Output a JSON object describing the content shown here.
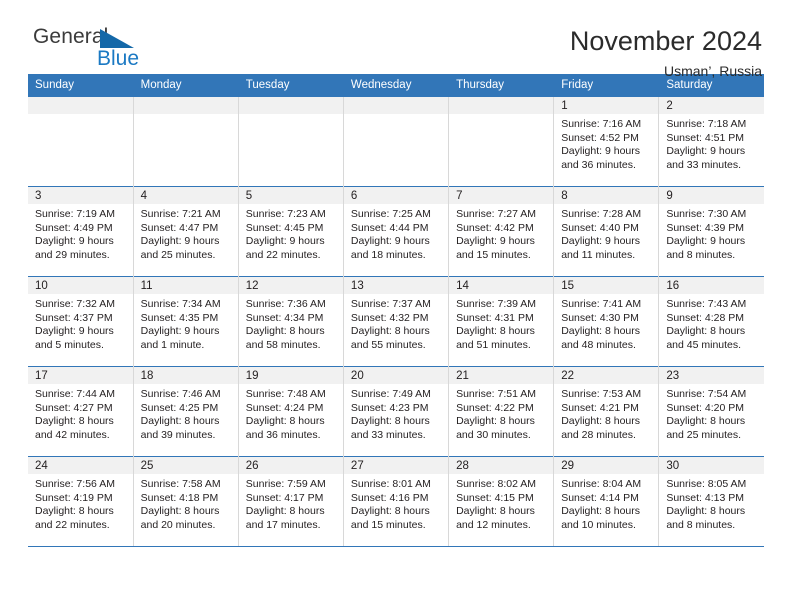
{
  "brand": {
    "name_top": "General",
    "name_bottom": "Blue",
    "triangle_color": "#1468a8",
    "blue_color": "#1b79c3"
  },
  "header": {
    "title": "November 2024",
    "subtitle": "Usman’, Russia"
  },
  "theme": {
    "header_blue": "#3276b8",
    "daynum_band": "#f1f1f1",
    "cell_divider": "#d8d8d8",
    "text": "#231f20"
  },
  "weekdays": [
    "Sunday",
    "Monday",
    "Tuesday",
    "Wednesday",
    "Thursday",
    "Friday",
    "Saturday"
  ],
  "labels": {
    "sunrise": "Sunrise:",
    "sunset": "Sunset:",
    "daylight": "Daylight:"
  },
  "weeks": [
    [
      {
        "day": "",
        "empty": true
      },
      {
        "day": "",
        "empty": true
      },
      {
        "day": "",
        "empty": true
      },
      {
        "day": "",
        "empty": true
      },
      {
        "day": "",
        "empty": true
      },
      {
        "day": "1",
        "sunrise": "Sunrise: 7:16 AM",
        "sunset": "Sunset: 4:52 PM",
        "daylight": "Daylight: 9 hours and 36 minutes."
      },
      {
        "day": "2",
        "sunrise": "Sunrise: 7:18 AM",
        "sunset": "Sunset: 4:51 PM",
        "daylight": "Daylight: 9 hours and 33 minutes."
      }
    ],
    [
      {
        "day": "3",
        "sunrise": "Sunrise: 7:19 AM",
        "sunset": "Sunset: 4:49 PM",
        "daylight": "Daylight: 9 hours and 29 minutes."
      },
      {
        "day": "4",
        "sunrise": "Sunrise: 7:21 AM",
        "sunset": "Sunset: 4:47 PM",
        "daylight": "Daylight: 9 hours and 25 minutes."
      },
      {
        "day": "5",
        "sunrise": "Sunrise: 7:23 AM",
        "sunset": "Sunset: 4:45 PM",
        "daylight": "Daylight: 9 hours and 22 minutes."
      },
      {
        "day": "6",
        "sunrise": "Sunrise: 7:25 AM",
        "sunset": "Sunset: 4:44 PM",
        "daylight": "Daylight: 9 hours and 18 minutes."
      },
      {
        "day": "7",
        "sunrise": "Sunrise: 7:27 AM",
        "sunset": "Sunset: 4:42 PM",
        "daylight": "Daylight: 9 hours and 15 minutes."
      },
      {
        "day": "8",
        "sunrise": "Sunrise: 7:28 AM",
        "sunset": "Sunset: 4:40 PM",
        "daylight": "Daylight: 9 hours and 11 minutes."
      },
      {
        "day": "9",
        "sunrise": "Sunrise: 7:30 AM",
        "sunset": "Sunset: 4:39 PM",
        "daylight": "Daylight: 9 hours and 8 minutes."
      }
    ],
    [
      {
        "day": "10",
        "sunrise": "Sunrise: 7:32 AM",
        "sunset": "Sunset: 4:37 PM",
        "daylight": "Daylight: 9 hours and 5 minutes."
      },
      {
        "day": "11",
        "sunrise": "Sunrise: 7:34 AM",
        "sunset": "Sunset: 4:35 PM",
        "daylight": "Daylight: 9 hours and 1 minute."
      },
      {
        "day": "12",
        "sunrise": "Sunrise: 7:36 AM",
        "sunset": "Sunset: 4:34 PM",
        "daylight": "Daylight: 8 hours and 58 minutes."
      },
      {
        "day": "13",
        "sunrise": "Sunrise: 7:37 AM",
        "sunset": "Sunset: 4:32 PM",
        "daylight": "Daylight: 8 hours and 55 minutes."
      },
      {
        "day": "14",
        "sunrise": "Sunrise: 7:39 AM",
        "sunset": "Sunset: 4:31 PM",
        "daylight": "Daylight: 8 hours and 51 minutes."
      },
      {
        "day": "15",
        "sunrise": "Sunrise: 7:41 AM",
        "sunset": "Sunset: 4:30 PM",
        "daylight": "Daylight: 8 hours and 48 minutes."
      },
      {
        "day": "16",
        "sunrise": "Sunrise: 7:43 AM",
        "sunset": "Sunset: 4:28 PM",
        "daylight": "Daylight: 8 hours and 45 minutes."
      }
    ],
    [
      {
        "day": "17",
        "sunrise": "Sunrise: 7:44 AM",
        "sunset": "Sunset: 4:27 PM",
        "daylight": "Daylight: 8 hours and 42 minutes."
      },
      {
        "day": "18",
        "sunrise": "Sunrise: 7:46 AM",
        "sunset": "Sunset: 4:25 PM",
        "daylight": "Daylight: 8 hours and 39 minutes."
      },
      {
        "day": "19",
        "sunrise": "Sunrise: 7:48 AM",
        "sunset": "Sunset: 4:24 PM",
        "daylight": "Daylight: 8 hours and 36 minutes."
      },
      {
        "day": "20",
        "sunrise": "Sunrise: 7:49 AM",
        "sunset": "Sunset: 4:23 PM",
        "daylight": "Daylight: 8 hours and 33 minutes."
      },
      {
        "day": "21",
        "sunrise": "Sunrise: 7:51 AM",
        "sunset": "Sunset: 4:22 PM",
        "daylight": "Daylight: 8 hours and 30 minutes."
      },
      {
        "day": "22",
        "sunrise": "Sunrise: 7:53 AM",
        "sunset": "Sunset: 4:21 PM",
        "daylight": "Daylight: 8 hours and 28 minutes."
      },
      {
        "day": "23",
        "sunrise": "Sunrise: 7:54 AM",
        "sunset": "Sunset: 4:20 PM",
        "daylight": "Daylight: 8 hours and 25 minutes."
      }
    ],
    [
      {
        "day": "24",
        "sunrise": "Sunrise: 7:56 AM",
        "sunset": "Sunset: 4:19 PM",
        "daylight": "Daylight: 8 hours and 22 minutes."
      },
      {
        "day": "25",
        "sunrise": "Sunrise: 7:58 AM",
        "sunset": "Sunset: 4:18 PM",
        "daylight": "Daylight: 8 hours and 20 minutes."
      },
      {
        "day": "26",
        "sunrise": "Sunrise: 7:59 AM",
        "sunset": "Sunset: 4:17 PM",
        "daylight": "Daylight: 8 hours and 17 minutes."
      },
      {
        "day": "27",
        "sunrise": "Sunrise: 8:01 AM",
        "sunset": "Sunset: 4:16 PM",
        "daylight": "Daylight: 8 hours and 15 minutes."
      },
      {
        "day": "28",
        "sunrise": "Sunrise: 8:02 AM",
        "sunset": "Sunset: 4:15 PM",
        "daylight": "Daylight: 8 hours and 12 minutes."
      },
      {
        "day": "29",
        "sunrise": "Sunrise: 8:04 AM",
        "sunset": "Sunset: 4:14 PM",
        "daylight": "Daylight: 8 hours and 10 minutes."
      },
      {
        "day": "30",
        "sunrise": "Sunrise: 8:05 AM",
        "sunset": "Sunset: 4:13 PM",
        "daylight": "Daylight: 8 hours and 8 minutes."
      }
    ]
  ]
}
